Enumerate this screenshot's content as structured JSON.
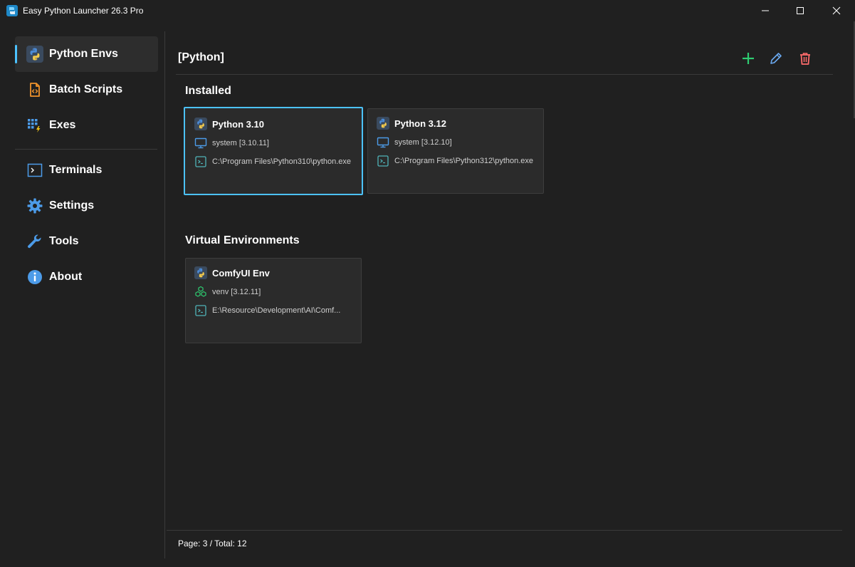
{
  "window": {
    "title": "Easy Python Launcher 26.3 Pro",
    "controls": [
      "minimize-icon",
      "maximize-icon",
      "close-icon"
    ]
  },
  "sidebar": {
    "items": [
      {
        "label": "Python Envs",
        "icon": "python-icon",
        "active": true
      },
      {
        "label": "Batch Scripts",
        "icon": "script-file-icon",
        "active": false
      },
      {
        "label": "Exes",
        "icon": "exe-grid-icon",
        "active": false
      },
      {
        "label": "Terminals",
        "icon": "terminal-icon",
        "active": false
      },
      {
        "label": "Settings",
        "icon": "gear-icon",
        "active": false
      },
      {
        "label": "Tools",
        "icon": "wrench-icon",
        "active": false
      },
      {
        "label": "About",
        "icon": "info-icon",
        "active": false
      }
    ]
  },
  "main": {
    "title": "[Python]",
    "actions": [
      {
        "name": "add",
        "icon": "plus-icon",
        "color": "#2ecc71"
      },
      {
        "name": "edit",
        "icon": "pencil-icon",
        "color": "#6aa9f0"
      },
      {
        "name": "delete",
        "icon": "trash-icon",
        "color": "#ff6b6b"
      }
    ],
    "installed": {
      "title": "Installed",
      "cards": [
        {
          "name": "Python 3.10",
          "meta": "system [3.10.11]",
          "path": "C:\\Program Files\\Python310\\python.exe",
          "selected": true,
          "type_icon": "monitor-icon"
        },
        {
          "name": "Python 3.12",
          "meta": "system [3.12.10]",
          "path": "C:\\Program Files\\Python312\\python.exe",
          "selected": false,
          "type_icon": "monitor-icon"
        }
      ]
    },
    "venvs": {
      "title": "Virtual Environments",
      "cards": [
        {
          "name": "ComfyUI Env",
          "meta": "venv [3.12.11]",
          "path": "E:\\Resource\\Development\\AI\\Comf...",
          "selected": false,
          "type_icon": "cubes-icon"
        }
      ]
    }
  },
  "footer": {
    "pagination": "Page: 3 / Total: 12"
  },
  "colors": {
    "background": "#202020",
    "card": "#2b2b2b",
    "accent": "#4cc2ff",
    "add": "#2ecc71",
    "edit": "#6aa9f0",
    "delete": "#ff6b6b"
  }
}
